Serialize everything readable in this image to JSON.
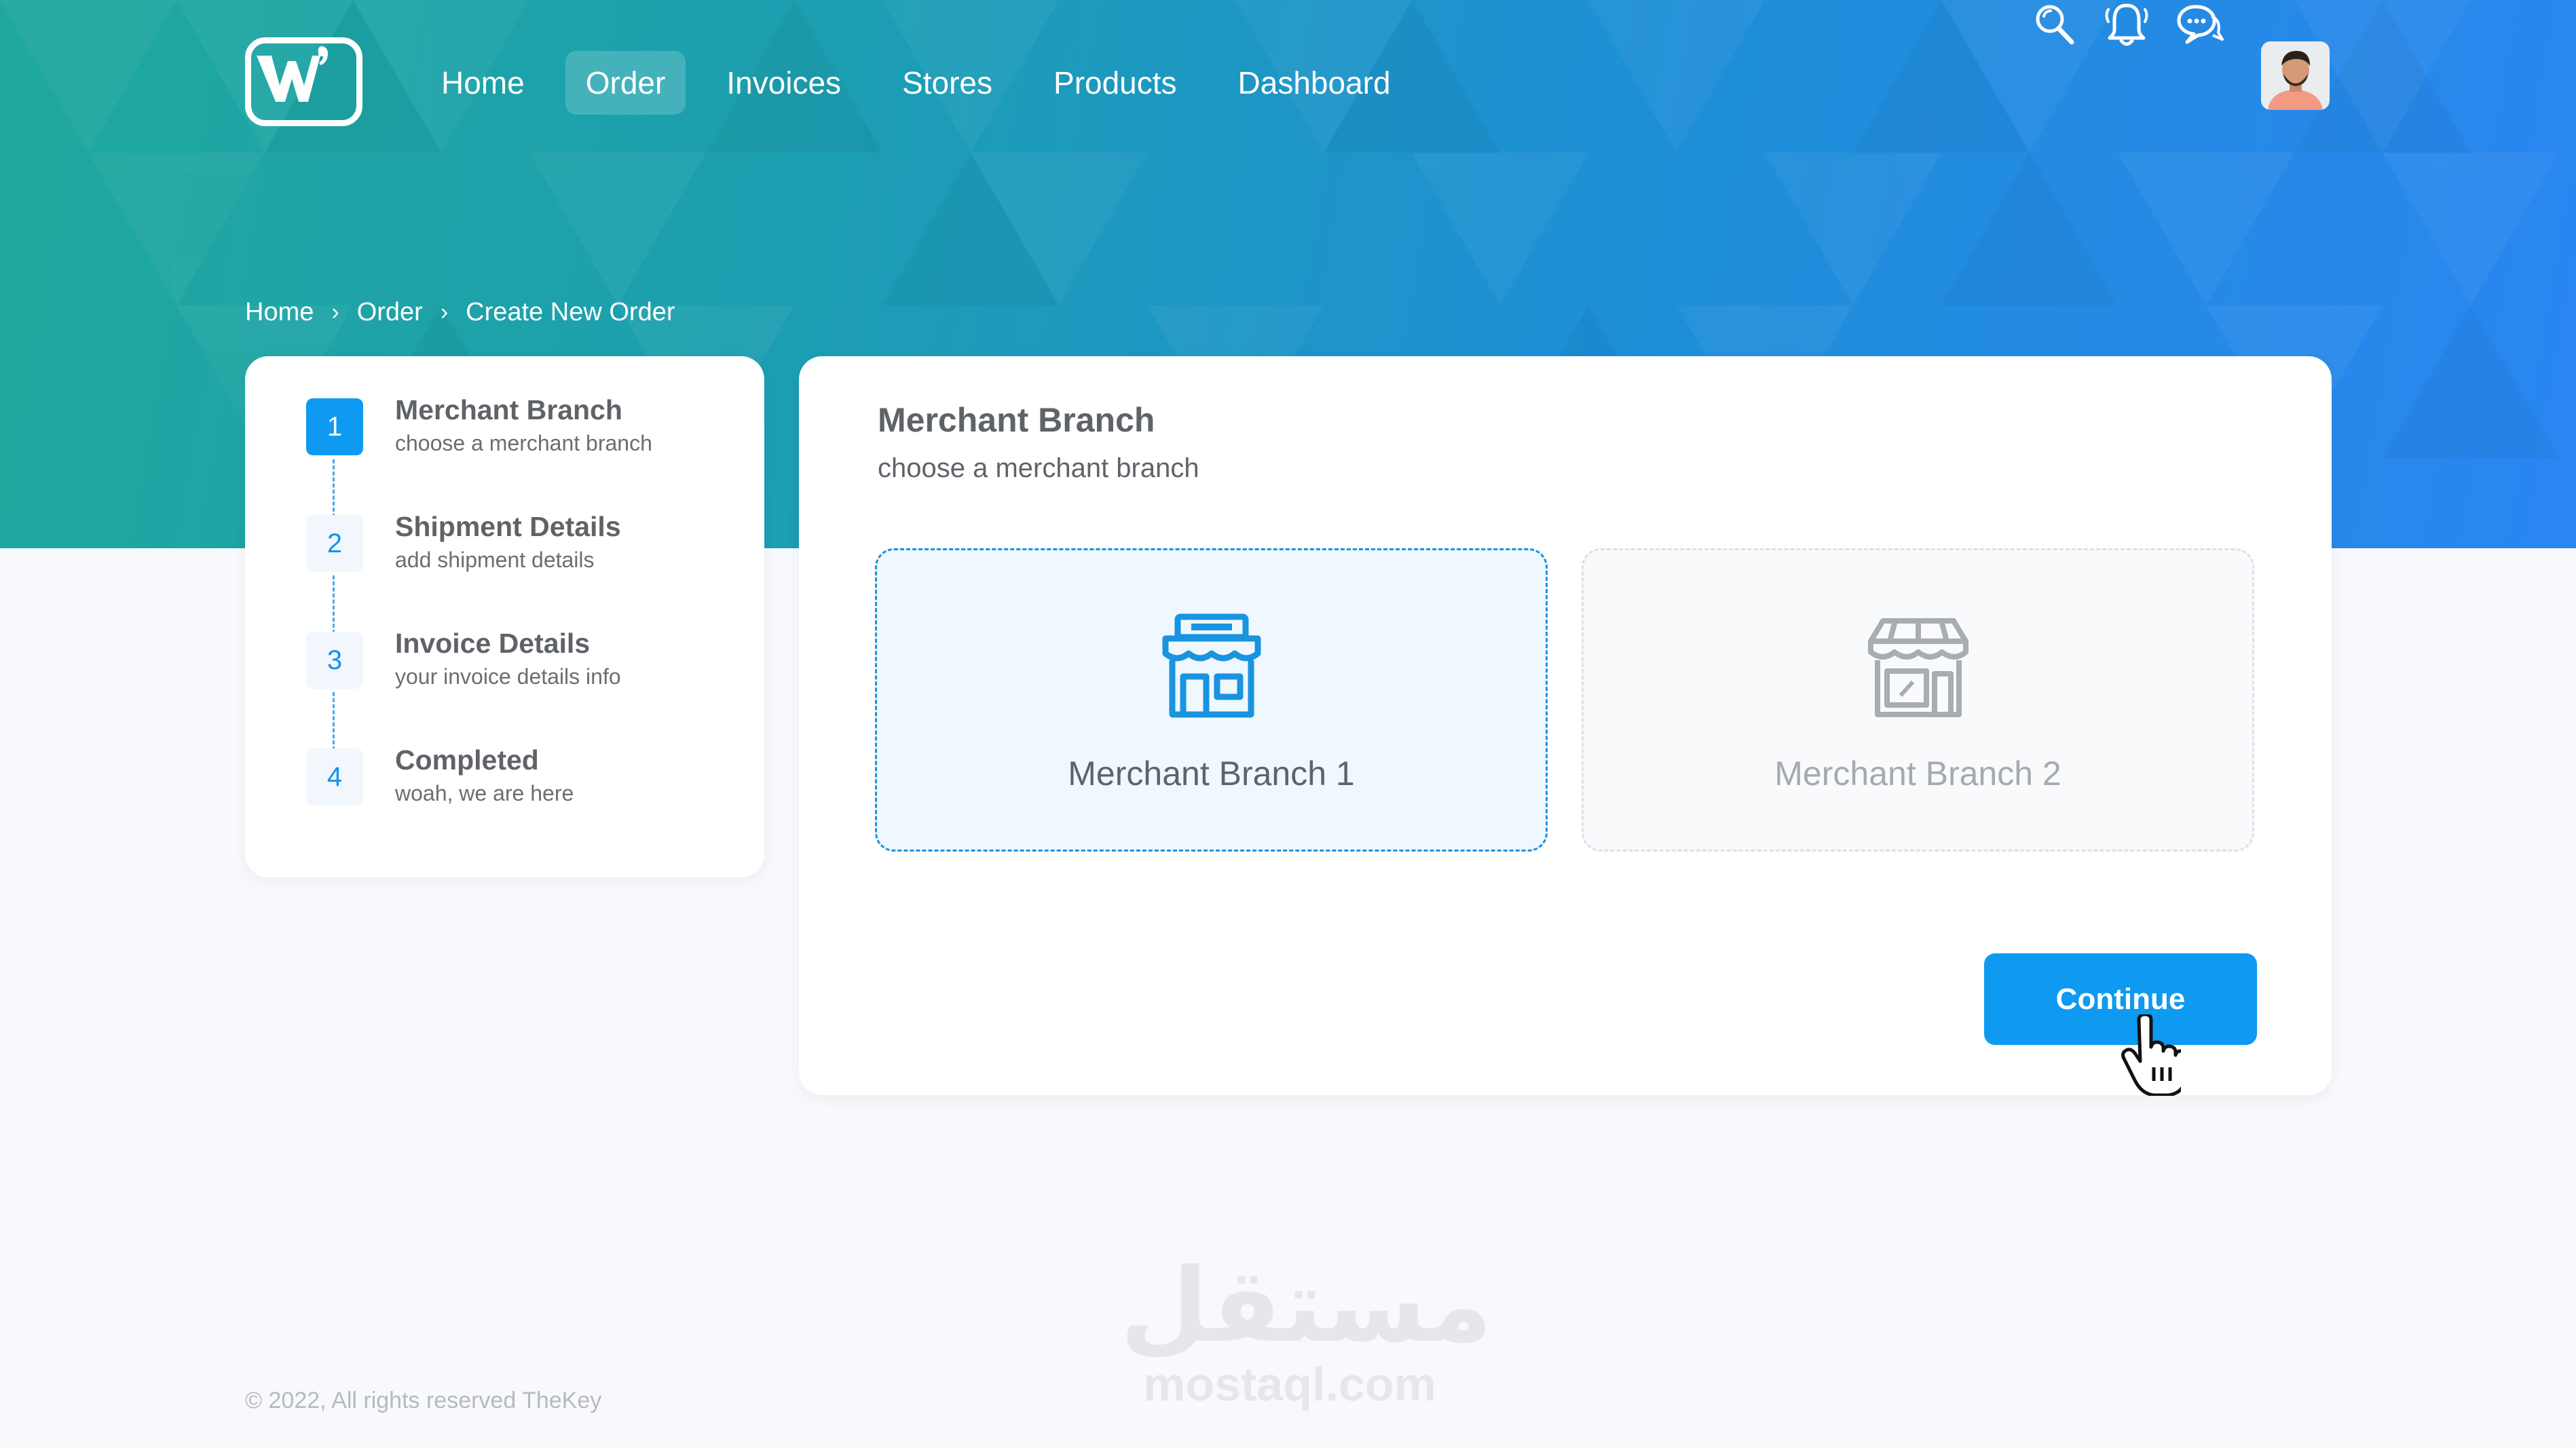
{
  "nav": {
    "items": [
      {
        "label": "Home",
        "active": false
      },
      {
        "label": "Order",
        "active": true
      },
      {
        "label": "Invoices",
        "active": false
      },
      {
        "label": "Stores",
        "active": false
      },
      {
        "label": "Products",
        "active": false
      },
      {
        "label": "Dashboard",
        "active": false
      }
    ]
  },
  "header": {
    "logo_letter": "W",
    "icons": [
      "search-icon",
      "bell-icon",
      "chat-icon"
    ]
  },
  "breadcrumb": {
    "items": [
      "Home",
      "Order",
      "Create New Order"
    ],
    "separator": "›"
  },
  "steps": [
    {
      "number": "1",
      "title": "Merchant Branch",
      "subtitle": "choose a merchant branch",
      "active": true
    },
    {
      "number": "2",
      "title": "Shipment Details",
      "subtitle": "add shipment details",
      "active": false
    },
    {
      "number": "3",
      "title": "Invoice Details",
      "subtitle": "your invoice details info",
      "active": false
    },
    {
      "number": "4",
      "title": "Completed",
      "subtitle": "woah, we are here",
      "active": false
    }
  ],
  "main": {
    "title": "Merchant Branch",
    "subtitle": "choose a merchant branch",
    "branches": [
      {
        "label": "Merchant Branch 1",
        "selected": true
      },
      {
        "label": "Merchant Branch 2",
        "selected": false
      }
    ],
    "continue_label": "Continue"
  },
  "footer": {
    "copyright": "© 2022, All rights reserved TheKey"
  },
  "watermark": {
    "arabic": "مستقل",
    "latin": "mostaql.com"
  },
  "colors": {
    "accent": "#0e9af0",
    "hero_start": "#1fa89d",
    "hero_end": "#2a86f2",
    "background": "#f8f9fd"
  }
}
